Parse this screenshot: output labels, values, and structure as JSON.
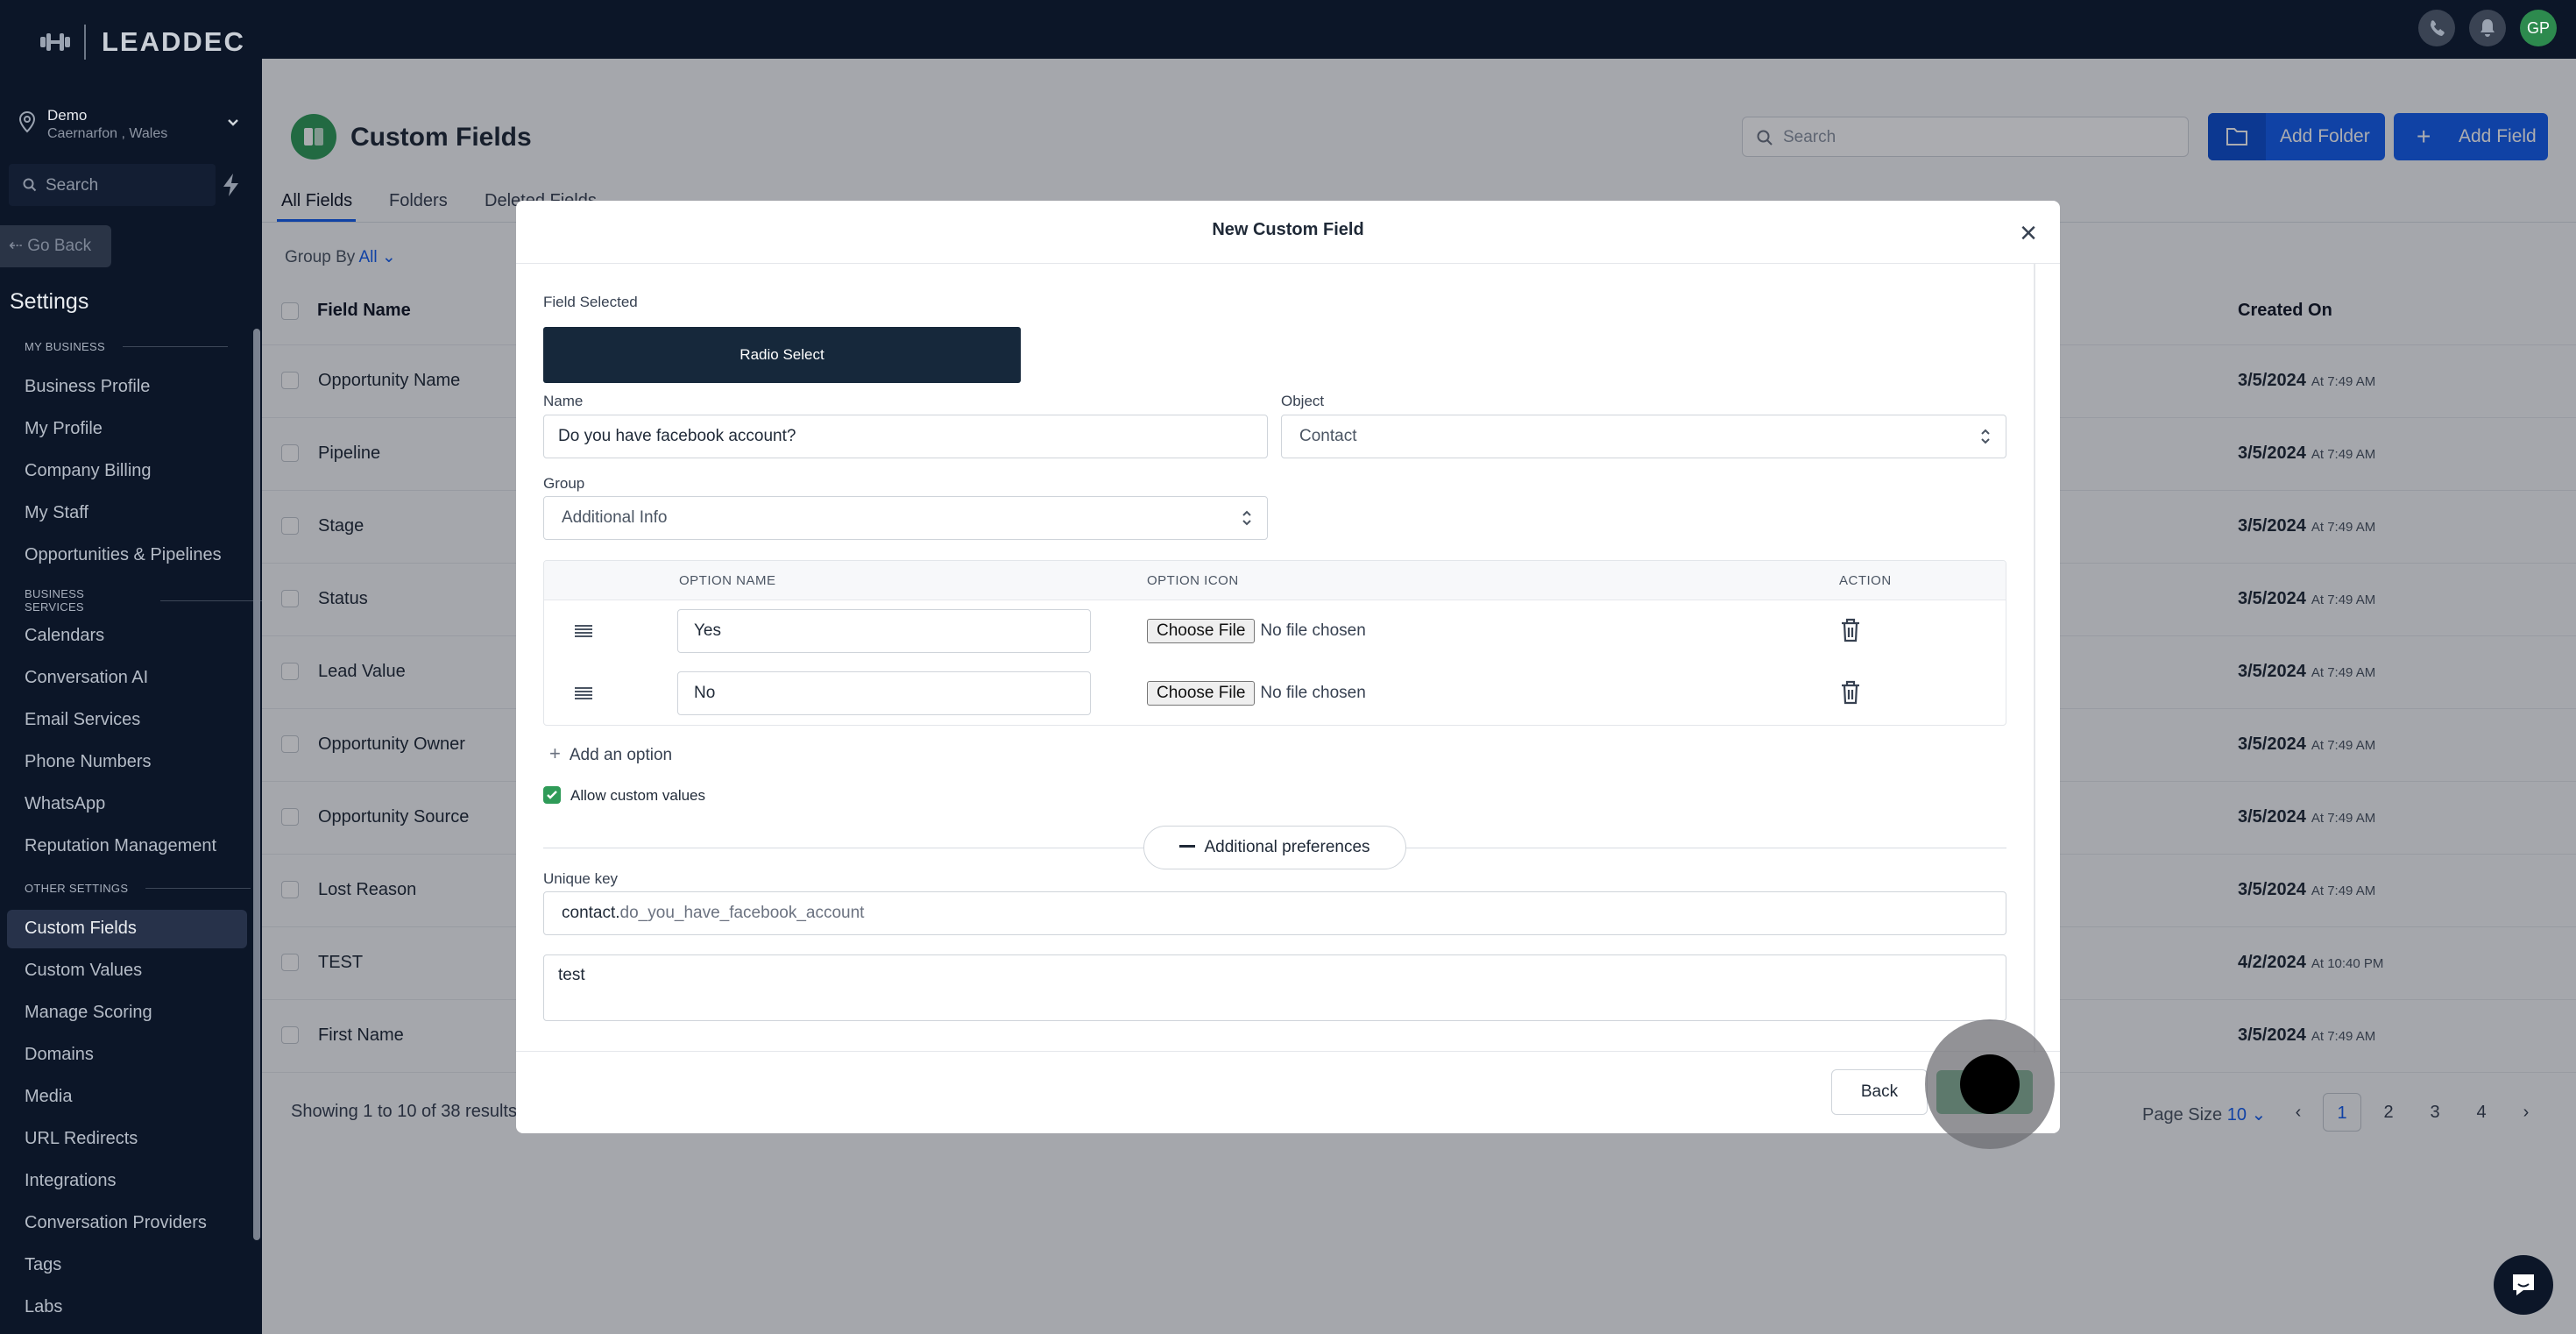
{
  "sidebar": {
    "logo_text": "LEADDEC",
    "location": {
      "name": "Demo",
      "sub": "Caernarfon , Wales"
    },
    "search_placeholder": "Search",
    "go_back": "Go Back",
    "settings_title": "Settings",
    "sections": [
      {
        "label": "MY BUSINESS"
      },
      {
        "label": "BUSINESS SERVICES"
      },
      {
        "label": "OTHER SETTINGS"
      }
    ],
    "items": [
      "Business Profile",
      "My Profile",
      "Company Billing",
      "My Staff",
      "Opportunities & Pipelines",
      "Calendars",
      "Conversation AI",
      "Email Services",
      "Phone Numbers",
      "WhatsApp",
      "Reputation Management",
      "Custom Fields",
      "Custom Values",
      "Manage Scoring",
      "Domains",
      "Media",
      "URL Redirects",
      "Integrations",
      "Conversation Providers",
      "Tags",
      "Labs"
    ],
    "active_item": "Custom Fields"
  },
  "topbar": {
    "avatar_initials": "GP"
  },
  "page": {
    "title": "Custom Fields",
    "search_placeholder": "Search",
    "add_folder": "Add Folder",
    "add_field": "Add Field",
    "tabs": [
      "All Fields",
      "Folders",
      "Deleted Fields"
    ],
    "group_by_label": "Group By",
    "group_by_value": "All",
    "columns": {
      "field_name": "Field Name",
      "created_on": "Created On"
    },
    "rows": [
      {
        "name": "Opportunity Name",
        "date": "3/5/2024",
        "time": "At 7:49 AM"
      },
      {
        "name": "Pipeline",
        "date": "3/5/2024",
        "time": "At 7:49 AM"
      },
      {
        "name": "Stage",
        "date": "3/5/2024",
        "time": "At 7:49 AM"
      },
      {
        "name": "Status",
        "date": "3/5/2024",
        "time": "At 7:49 AM"
      },
      {
        "name": "Lead Value",
        "date": "3/5/2024",
        "time": "At 7:49 AM"
      },
      {
        "name": "Opportunity Owner",
        "date": "3/5/2024",
        "time": "At 7:49 AM"
      },
      {
        "name": "Opportunity Source",
        "date": "3/5/2024",
        "time": "At 7:49 AM"
      },
      {
        "name": "Lost Reason",
        "date": "3/5/2024",
        "time": "At 7:49 AM"
      },
      {
        "name": "TEST",
        "date": "4/2/2024",
        "time": "At 10:40 PM"
      },
      {
        "name": "First Name",
        "date": "3/5/2024",
        "time": "At 7:49 AM"
      }
    ],
    "showing": "Showing 1 to 10 of 38 results",
    "page_size_label": "Page Size",
    "page_size_value": "10",
    "pages": [
      "1",
      "2",
      "3",
      "4"
    ],
    "current_page": "1"
  },
  "modal": {
    "title": "New Custom Field",
    "field_selected_label": "Field Selected",
    "field_selected_value": "Radio Select",
    "name_label": "Name",
    "name_value": "Do you have facebook account?",
    "object_label": "Object",
    "object_value": "Contact",
    "group_label": "Group",
    "group_value": "Additional Info",
    "options_columns": {
      "name": "OPTION NAME",
      "icon": "OPTION ICON",
      "action": "ACTION"
    },
    "options": [
      {
        "name": "Yes",
        "file_button": "Choose File",
        "file_status": "No file chosen"
      },
      {
        "name": "No",
        "file_button": "Choose File",
        "file_status": "No file chosen"
      }
    ],
    "add_option": "Add an option",
    "allow_custom_values": "Allow custom values",
    "additional_preferences": "Additional preferences",
    "unique_key_label": "Unique key",
    "unique_key_prefix": "contact.",
    "unique_key_value": "do_you_have_facebook_account",
    "description_value": "test",
    "back_button": "Back"
  },
  "colors": {
    "brand": "#155eef",
    "success": "#2f9b58",
    "sidebar_bg": "#0c1628",
    "selected_field_bg": "#16283b"
  }
}
